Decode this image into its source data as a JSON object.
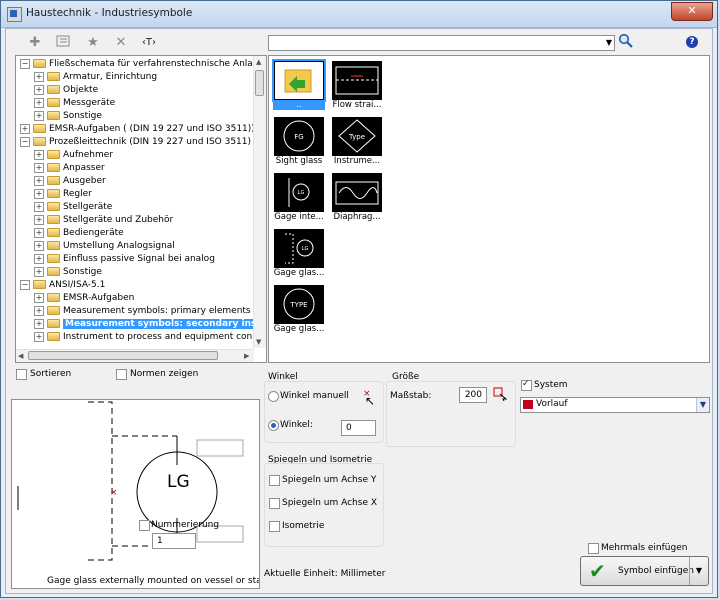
{
  "window": {
    "title": "Haustechnik - Industriesymbole",
    "close_glyph": "✕"
  },
  "toolbar": {
    "icons": [
      "add-icon",
      "properties-icon",
      "favorite-star-icon",
      "delete-icon",
      "text-icon"
    ],
    "text_icon_label": "‹T›",
    "search": {
      "value": ""
    }
  },
  "tree": {
    "items": [
      {
        "label": "Fließschemata für verfahrenstechnische Anlagen",
        "level": 0,
        "expander": "−"
      },
      {
        "label": "Armatur, Einrichtung",
        "level": 1,
        "expander": "+"
      },
      {
        "label": "Objekte",
        "level": 1,
        "expander": "+"
      },
      {
        "label": "Messgeräte",
        "level": 1,
        "expander": "+"
      },
      {
        "label": "Sonstige",
        "level": 1,
        "expander": "+"
      },
      {
        "label": "EMSR-Aufgaben ( (DIN 19 227 und ISO 3511))",
        "level": 0,
        "expander": "+"
      },
      {
        "label": "Prozeßleittechnik (DIN 19 227 und ISO 3511)",
        "level": 0,
        "expander": "−"
      },
      {
        "label": "Aufnehmer",
        "level": 1,
        "expander": "+"
      },
      {
        "label": "Anpasser",
        "level": 1,
        "expander": "+"
      },
      {
        "label": "Ausgeber",
        "level": 1,
        "expander": "+"
      },
      {
        "label": "Regler",
        "level": 1,
        "expander": "+"
      },
      {
        "label": "Stellgeräte",
        "level": 1,
        "expander": "+"
      },
      {
        "label": "Stellgeräte und Zubehör",
        "level": 1,
        "expander": "+"
      },
      {
        "label": "Bediengeräte",
        "level": 1,
        "expander": "+"
      },
      {
        "label": "Umstellung Analogsignal",
        "level": 1,
        "expander": "+"
      },
      {
        "label": "Einfluss passive Signal bei analog",
        "level": 1,
        "expander": "+"
      },
      {
        "label": "Sonstige",
        "level": 1,
        "expander": "+"
      },
      {
        "label": "ANSI/ISA-5.1",
        "level": 0,
        "expander": "−"
      },
      {
        "label": "EMSR-Aufgaben",
        "level": 1,
        "expander": "+"
      },
      {
        "label": "Measurement symbols: primary elements",
        "level": 1,
        "expander": "+"
      },
      {
        "label": "Measurement symbols: secondary instr",
        "level": 1,
        "expander": "+",
        "selected": true
      },
      {
        "label": "Instrument to process and equipment connecti",
        "level": 1,
        "expander": "+"
      }
    ]
  },
  "gallery": {
    "tiles": [
      {
        "label": "..",
        "name": "tile-parent-folder",
        "selected": true
      },
      {
        "label": "Flow strai...",
        "name": "tile-flow-strainer"
      },
      {
        "label": "Sight glass",
        "name": "tile-sight-glass",
        "symbol": "FG"
      },
      {
        "label": "Instrume...",
        "name": "tile-instrument-type",
        "symbol": "Type"
      },
      {
        "label": "Gage inte...",
        "name": "tile-gage-integral",
        "symbol": "LG"
      },
      {
        "label": "Diaphrag...",
        "name": "tile-diaphragm"
      },
      {
        "label": "Gage glas...",
        "name": "tile-gage-glass-1",
        "symbol": "LG"
      },
      {
        "label": "Gage glas...",
        "name": "tile-gage-glass-2",
        "symbol": "TYPE"
      }
    ]
  },
  "options": {
    "sortieren": "Sortieren",
    "normen_zeigen": "Normen zeigen"
  },
  "preview": {
    "symbol_text": "LG",
    "numbering_label": "Nummerierung",
    "numbering_value": "1",
    "caption": "Gage glass externally mounted on vessel or standpipe"
  },
  "winkel": {
    "title": "Winkel",
    "manual_label": "Winkel manuell",
    "angle_label": "Winkel:",
    "angle_value": "0"
  },
  "groesse": {
    "title": "Größe",
    "scale_label": "Maßstab:",
    "scale_value": "200"
  },
  "system": {
    "label": "System",
    "checked": true,
    "value": "Vorlauf",
    "swatch_color": "#c4001f"
  },
  "spiegeln": {
    "title": "Spiegeln und Isometrie",
    "mirror_y": "Spiegeln um Achse Y",
    "mirror_x": "Spiegeln um Achse X",
    "isometrie": "Isometrie"
  },
  "footer": {
    "unit": "Aktuelle Einheit: Millimeter",
    "mehrmals": "Mehrmals einfügen",
    "insert_button": "Symbol einfügen"
  }
}
